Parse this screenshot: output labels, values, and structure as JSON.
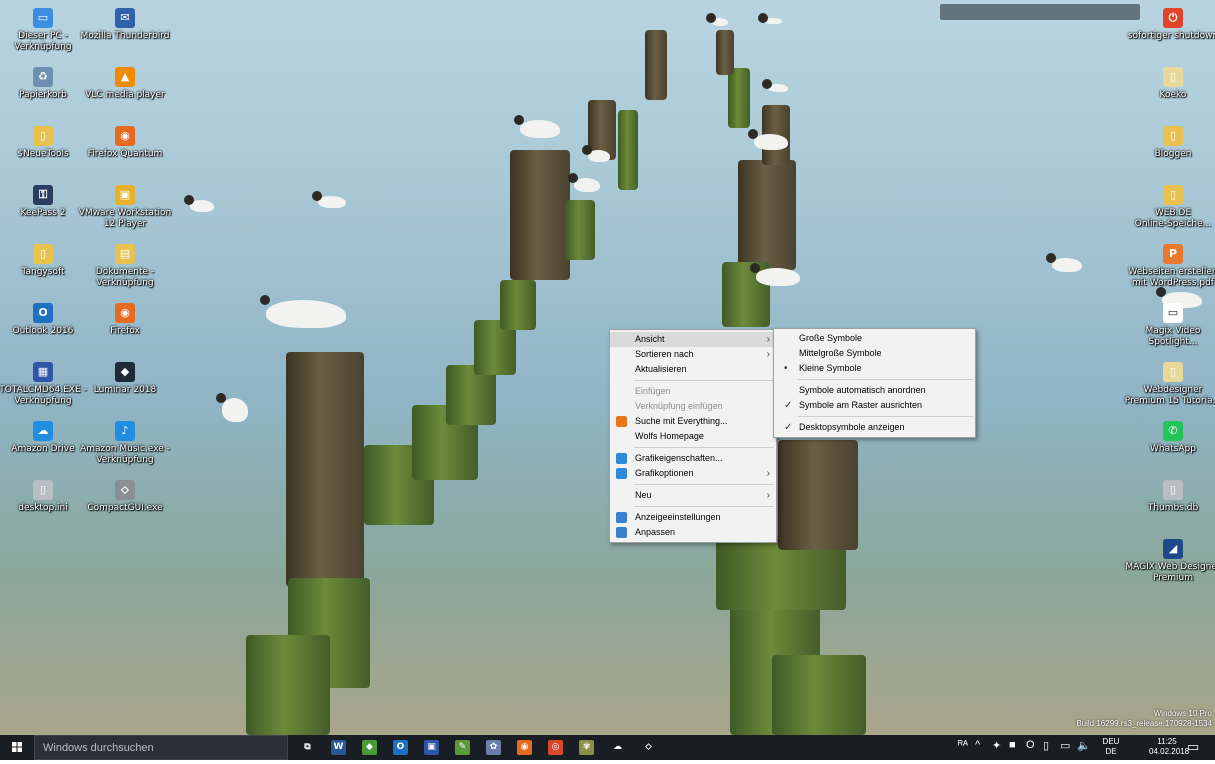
{
  "desktop_icons_left": [
    {
      "label": "Dieser PC -\nVerknüpfung",
      "icon": "computer-icon",
      "color": "#3d8ee0",
      "glyph": "▭"
    },
    {
      "label": "Mozilla Thunderbird",
      "icon": "thunderbird-icon",
      "color": "#2f62a8",
      "glyph": "✉"
    },
    {
      "label": "Papierkorb",
      "icon": "recycle-bin-icon",
      "color": "#6f8fb0",
      "glyph": "♻"
    },
    {
      "label": "VLC media player",
      "icon": "vlc-icon",
      "color": "#f08a00",
      "glyph": "▲"
    },
    {
      "label": "$NeueTools",
      "icon": "folder-icon",
      "color": "#e8c14e",
      "glyph": "▯"
    },
    {
      "label": "Firefox Quantum",
      "icon": "firefox-icon",
      "color": "#e66a1f",
      "glyph": "◉"
    },
    {
      "label": "KeePass 2",
      "icon": "keepass-icon",
      "color": "#2c3e60",
      "glyph": "⚿"
    },
    {
      "label": "VMware Workstation\n12 Player",
      "icon": "vmware-icon",
      "color": "#e7b12a",
      "glyph": "▣"
    },
    {
      "label": "Tangysoft",
      "icon": "folder-icon",
      "color": "#e8c14e",
      "glyph": "▯"
    },
    {
      "label": "Dokumente -\nVerknüpfung",
      "icon": "documents-icon",
      "color": "#e8c14e",
      "glyph": "▤"
    },
    {
      "label": "Outlook 2016",
      "icon": "outlook-icon",
      "color": "#1f6fc3",
      "glyph": "O"
    },
    {
      "label": "Firefox",
      "icon": "firefox-icon",
      "color": "#e66a1f",
      "glyph": "◉"
    },
    {
      "label": "TOTALCMD64.EXE -\nVerknüpfung",
      "icon": "total-commander-icon",
      "color": "#2f55a8",
      "glyph": "▦"
    },
    {
      "label": "Luminar 2018",
      "icon": "luminar-icon",
      "color": "#1e2c3a",
      "glyph": "◆"
    },
    {
      "label": "Amazon Drive",
      "icon": "amazon-drive-icon",
      "color": "#1f8ee0",
      "glyph": "☁"
    },
    {
      "label": "Amazon Music.exe -\nVerknüpfung",
      "icon": "amazon-music-icon",
      "color": "#1f8ee0",
      "glyph": "♪"
    },
    {
      "label": "desktop.ini",
      "icon": "file-icon",
      "color": "#b8bec4",
      "glyph": "▯"
    },
    {
      "label": "CompactGUI.exe",
      "icon": "app-icon",
      "color": "#8a8f95",
      "glyph": "⬦"
    }
  ],
  "desktop_icons_right": [
    {
      "label": "sofortiger shutdown",
      "icon": "shutdown-icon",
      "color": "#e0452b",
      "glyph": "⏻"
    },
    {
      "label": "Koeko",
      "icon": "file-icon",
      "color": "#e8d89a",
      "glyph": "▯"
    },
    {
      "label": "Bloggen",
      "icon": "folder-icon",
      "color": "#e8c14e",
      "glyph": "▯"
    },
    {
      "label": "WEB.DE\nOnline-Speiche...",
      "icon": "folder-icon",
      "color": "#e8c14e",
      "glyph": "▯"
    },
    {
      "label": "Webseiten erstellen\nmit WordPress.pdf",
      "icon": "pdf-icon",
      "color": "#e8782c",
      "glyph": "P"
    },
    {
      "label": "Magix Video\nSpotlight...",
      "icon": "video-icon",
      "color": "#ffffff",
      "glyph": "▭"
    },
    {
      "label": "Webdesigner\nPremium 15 Tutoria...",
      "icon": "file-icon",
      "color": "#e8d89a",
      "glyph": "▯"
    },
    {
      "label": "WhatsApp",
      "icon": "whatsapp-icon",
      "color": "#25c35b",
      "glyph": "✆"
    },
    {
      "label": "Thumbs.db",
      "icon": "file-icon",
      "color": "#b8bec4",
      "glyph": "▯"
    },
    {
      "label": "MAGIX Web Designer\nPremium",
      "icon": "magix-icon",
      "color": "#1f4a8a",
      "glyph": "◢"
    }
  ],
  "context_menu": {
    "items": [
      {
        "label": "Ansicht",
        "submenu": true,
        "hover": true
      },
      {
        "label": "Sortieren nach",
        "submenu": true
      },
      {
        "label": "Aktualisieren"
      },
      {
        "sep": true
      },
      {
        "label": "Einfügen",
        "disabled": true
      },
      {
        "label": "Verknüpfung einfügen",
        "disabled": true
      },
      {
        "label": "Suche mit Everything...",
        "icon": "everything-search-icon",
        "color": "#e8771c"
      },
      {
        "label": "Wolfs Homepage"
      },
      {
        "sep": true
      },
      {
        "label": "Grafikeigenschaften...",
        "icon": "graphics-icon",
        "color": "#2d8ad8"
      },
      {
        "label": "Grafikoptionen",
        "icon": "graphics-icon",
        "color": "#2d8ad8",
        "submenu": true
      },
      {
        "sep": true
      },
      {
        "label": "Neu",
        "submenu": true
      },
      {
        "sep": true
      },
      {
        "label": "Anzeigeeinstellungen",
        "icon": "display-icon",
        "color": "#3a7fd0"
      },
      {
        "label": "Anpassen",
        "icon": "personalize-icon",
        "color": "#3a7fd0"
      }
    ]
  },
  "view_submenu": {
    "items": [
      {
        "label": "Große Symbole"
      },
      {
        "label": "Mittelgroße Symbole"
      },
      {
        "label": "Kleine Symbole",
        "mark": "•"
      },
      {
        "sep": true
      },
      {
        "label": "Symbole automatisch anordnen"
      },
      {
        "label": "Symbole am Raster ausrichten",
        "mark": "✓"
      },
      {
        "sep": true
      },
      {
        "label": "Desktopsymbole anzeigen",
        "mark": "✓"
      }
    ]
  },
  "taskbar": {
    "search_placeholder": "Windows durchsuchen",
    "apps": [
      {
        "name": "task-view-icon",
        "glyph": "⧉",
        "color": "#191e24"
      },
      {
        "name": "word-icon",
        "glyph": "W",
        "color": "#2b5797"
      },
      {
        "name": "app-green-icon",
        "glyph": "◆",
        "color": "#4a9a3a"
      },
      {
        "name": "outlook-icon",
        "glyph": "O",
        "color": "#1f6fc3"
      },
      {
        "name": "floppy-save-icon",
        "glyph": "▣",
        "color": "#2f55a8"
      },
      {
        "name": "notepad-icon",
        "glyph": "✎",
        "color": "#5b9a3a"
      },
      {
        "name": "paint-icon",
        "glyph": "✿",
        "color": "#6a7fae"
      },
      {
        "name": "firefox-icon",
        "glyph": "◉",
        "color": "#e66a1f"
      },
      {
        "name": "chrome-icon",
        "glyph": "◎",
        "color": "#d9472b"
      },
      {
        "name": "plant-icon",
        "glyph": "✾",
        "color": "#8a8f4a"
      },
      {
        "name": "cloud-upload-icon",
        "glyph": "☁",
        "color": "#191e24"
      },
      {
        "name": "tool-icon",
        "glyph": "⬦",
        "color": "#191e24"
      }
    ],
    "tray_icons": [
      {
        "name": "people-icon",
        "glyph": "ᴿᴬ"
      },
      {
        "name": "chevron-up-icon",
        "glyph": "^"
      },
      {
        "name": "network-tray-icon",
        "glyph": "✦"
      },
      {
        "name": "app-tray-icon",
        "glyph": "■"
      },
      {
        "name": "onedrive-icon",
        "glyph": "O"
      },
      {
        "name": "battery-icon",
        "glyph": "▯"
      },
      {
        "name": "display-tray-icon",
        "glyph": "▭"
      },
      {
        "name": "volume-icon",
        "glyph": "🔈"
      }
    ],
    "lang_top": "DEU",
    "lang_bottom": "DE",
    "time": "11:25",
    "date": "04.02.2018"
  },
  "watermark": {
    "line1": "Windows 10 Pro",
    "line2": "Build 16299.rs3_release.170928-1534"
  }
}
